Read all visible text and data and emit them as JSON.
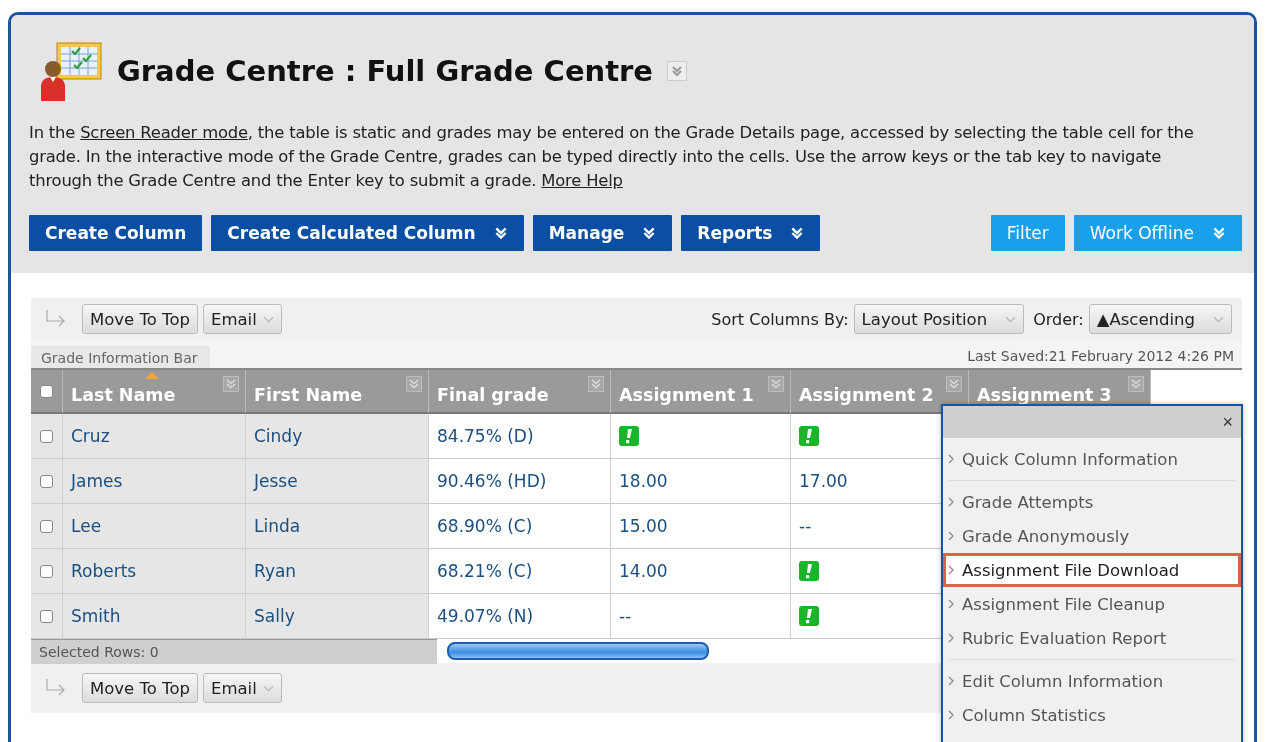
{
  "page": {
    "title": "Grade Centre : Full Grade Centre"
  },
  "intro": [
    {
      "kind": "text",
      "text": "In the "
    },
    {
      "kind": "link",
      "text": "Screen Reader mode"
    },
    {
      "kind": "text",
      "text": ", the table is static and grades may be entered on the Grade Details page, accessed by selecting the table cell for the grade. In the interactive mode of the Grade Centre, grades can be typed directly into the cells. Use the arrow keys or the tab key to navigate through the Grade Centre and the Enter key to submit a grade. "
    },
    {
      "kind": "link",
      "text": "More Help"
    }
  ],
  "action_buttons": [
    {
      "label": "Create Column",
      "kind": "primary",
      "menu": false
    },
    {
      "label": "Create Calculated Column",
      "kind": "primary",
      "menu": true
    },
    {
      "label": "Manage",
      "kind": "primary",
      "menu": true
    },
    {
      "label": "Reports",
      "kind": "primary",
      "menu": true
    },
    {
      "label": "Filter",
      "kind": "secondary",
      "menu": false
    },
    {
      "label": "Work Offline",
      "kind": "secondary",
      "menu": true
    }
  ],
  "top_toolbar": {
    "move_button": "Move To Top",
    "email_button": "Email",
    "sort_label": "Sort Columns By:",
    "sort_value": "Layout Position",
    "order_label": "Order:",
    "order_value": "▲Ascending"
  },
  "info_bar": {
    "tab": "Grade Information Bar",
    "last_saved": "Last Saved:21 February 2012 4:26 PM"
  },
  "table": {
    "select_all_checked": false,
    "columns": [
      {
        "label": "Last Name",
        "sorted": true
      },
      {
        "label": "First Name",
        "sorted": false
      },
      {
        "label": "Final grade",
        "sorted": false
      },
      {
        "label": "Assignment 1",
        "sorted": false
      },
      {
        "label": "Assignment 2",
        "sorted": false
      },
      {
        "label": "Assignment 3",
        "sorted": false
      }
    ],
    "rows": [
      {
        "checked": false,
        "last_name": "Cruz",
        "first_name": "Cindy",
        "final_grade": "84.75% (D)",
        "assignments": [
          {
            "kind": "needs_grading"
          },
          {
            "kind": "needs_grading"
          }
        ]
      },
      {
        "checked": false,
        "last_name": "James",
        "first_name": "Jesse",
        "final_grade": "90.46% (HD)",
        "assignments": [
          {
            "kind": "score",
            "text": "18.00"
          },
          {
            "kind": "score",
            "text": "17.00"
          }
        ]
      },
      {
        "checked": false,
        "last_name": "Lee",
        "first_name": "Linda",
        "final_grade": "68.90% (C)",
        "assignments": [
          {
            "kind": "score",
            "text": "15.00"
          },
          {
            "kind": "score",
            "text": "--"
          }
        ]
      },
      {
        "checked": false,
        "last_name": "Roberts",
        "first_name": "Ryan",
        "final_grade": "68.21% (C)",
        "assignments": [
          {
            "kind": "score",
            "text": "14.00"
          },
          {
            "kind": "needs_grading"
          }
        ]
      },
      {
        "checked": false,
        "last_name": "Smith",
        "first_name": "Sally",
        "final_grade": "49.07% (N)",
        "assignments": [
          {
            "kind": "score",
            "text": "--"
          },
          {
            "kind": "needs_grading"
          }
        ]
      }
    ],
    "selected_rows": "Selected Rows: 0"
  },
  "bottom_toolbar": {
    "move_button": "Move To Top",
    "email_button": "Email"
  },
  "column_menu": {
    "close": "×",
    "groups": [
      [
        {
          "label": "Quick Column Information",
          "highlighted": false
        }
      ],
      [
        {
          "label": "Grade Attempts",
          "highlighted": false
        },
        {
          "label": "Grade Anonymously",
          "highlighted": false
        },
        {
          "label": "Assignment File Download",
          "highlighted": true
        },
        {
          "label": "Assignment File Cleanup",
          "highlighted": false
        },
        {
          "label": "Rubric Evaluation Report",
          "highlighted": false
        }
      ],
      [
        {
          "label": "Edit Column Information",
          "highlighted": false
        },
        {
          "label": "Column Statistics",
          "highlighted": false
        }
      ]
    ]
  }
}
